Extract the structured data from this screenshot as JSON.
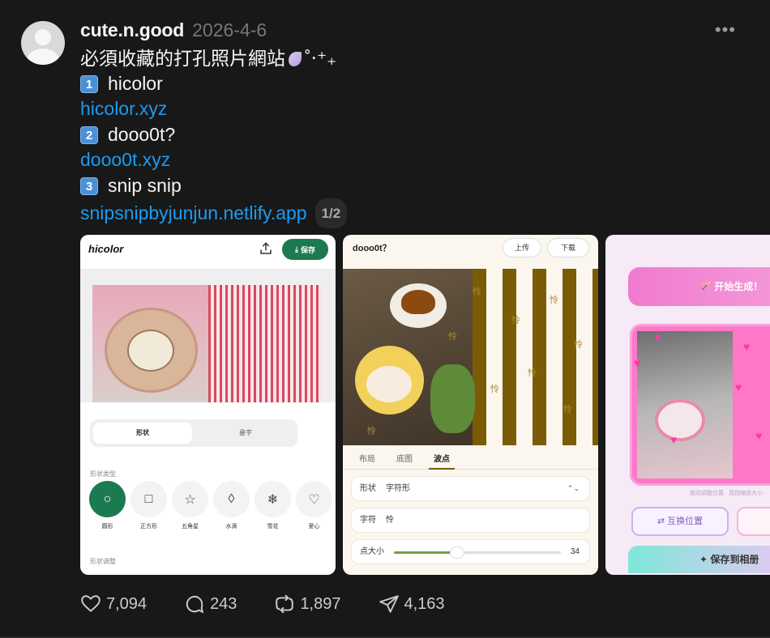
{
  "post": {
    "username": "cute.n.good",
    "date": "2026-4-6",
    "more_label": "•••",
    "lines": {
      "intro": "必須收藏的打孔照片網站",
      "intro_emoji": "˚‧⁺₊",
      "n1": "1",
      "item1": "hicolor",
      "link1": "hicolor.xyz",
      "n2": "2",
      "item2": "dooo0t?",
      "link2": "dooo0t.xyz",
      "n3": "3",
      "item3": "snip snip",
      "link3": "snipsnipbyjunjun.netlify.app",
      "pager": "1/2"
    }
  },
  "card1": {
    "logo": "hicolor",
    "share_icon": "upload-icon",
    "save_label": "保存",
    "seg_on": "形状",
    "seg_off": "叠字",
    "section1": "形状类型",
    "section2": "形状调整",
    "shapes": [
      {
        "label": "圆形",
        "glyph": "○"
      },
      {
        "label": "正方形",
        "glyph": "□"
      },
      {
        "label": "五角星",
        "glyph": "☆"
      },
      {
        "label": "水滴",
        "glyph": "◊"
      },
      {
        "label": "雪花",
        "glyph": "❄"
      },
      {
        "label": "爱心",
        "glyph": "♡"
      }
    ]
  },
  "card2": {
    "title": "dooo0t？",
    "upload": "上传",
    "download": "下载",
    "glyph": "怜",
    "tabs": [
      "布局",
      "底图",
      "波点"
    ],
    "shape_label": "形状",
    "shape_value": "字符形",
    "char_label": "字符",
    "char_value": "怜",
    "size_label": "点大小",
    "size_value": "34",
    "size_fraction": 0.38
  },
  "card3": {
    "generate": "🪄 开始生成！",
    "hint": "拖动调整位置 · 双指缩放大小",
    "swap": "⇄ 互换位置",
    "save_album": "✦ 保存到相册"
  },
  "actions": {
    "likes": "7,094",
    "comments": "243",
    "reposts": "1,897",
    "shares": "4,163"
  }
}
